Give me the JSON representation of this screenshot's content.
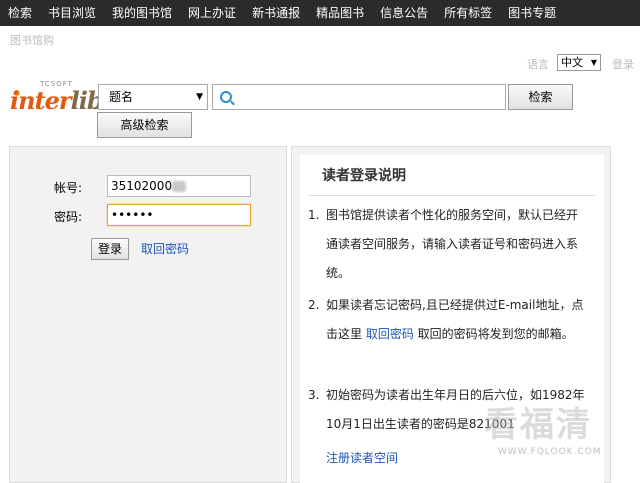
{
  "nav": {
    "items": [
      "检索",
      "书目浏览",
      "我的图书馆",
      "网上办证",
      "新书通报",
      "精品图书",
      "信息公告",
      "所有标签",
      "图书专题"
    ]
  },
  "breadcrumb": "图书馆购",
  "lang": {
    "label": "语言",
    "selected": "中文",
    "login_label": "登录"
  },
  "logo": {
    "small": "TCSOFT",
    "word_a": "inter",
    "word_b": "lib"
  },
  "search": {
    "type_selected": "题名",
    "query": "",
    "button": "检索",
    "advanced_button": "高级检索"
  },
  "login": {
    "account_label": "帐号:",
    "account_value": "35102000",
    "password_label": "密码:",
    "password_value": "••••••",
    "login_button": "登录",
    "retrieve_link": "取回密码"
  },
  "instructions": {
    "title": "读者登录说明",
    "items": [
      {
        "num": "1.",
        "text": "图书馆提供读者个性化的服务空间，默认已经开通读者空间服务，请输入读者证号和密码进入系统。"
      },
      {
        "num": "2.",
        "text_before": "如果读者忘记密码,且已经提供过E-mail地址，点击这里 ",
        "link": "取回密码",
        "text_after": " 取回的密码将发到您的邮箱。"
      },
      {
        "num": "3.",
        "text": "初始密码为读者出生年月日的后六位，如1982年10月1日出生读者的密码是821001"
      }
    ],
    "register_link": "注册读者空间"
  },
  "watermark": {
    "big": "看福清",
    "small": "WWW.FQLOOK.COM"
  },
  "colors": {
    "nav_bg": "#2b2b2b",
    "link": "#1a56b8",
    "panel_bg": "#f2f2f2",
    "logo_orange": "#e05a10"
  }
}
